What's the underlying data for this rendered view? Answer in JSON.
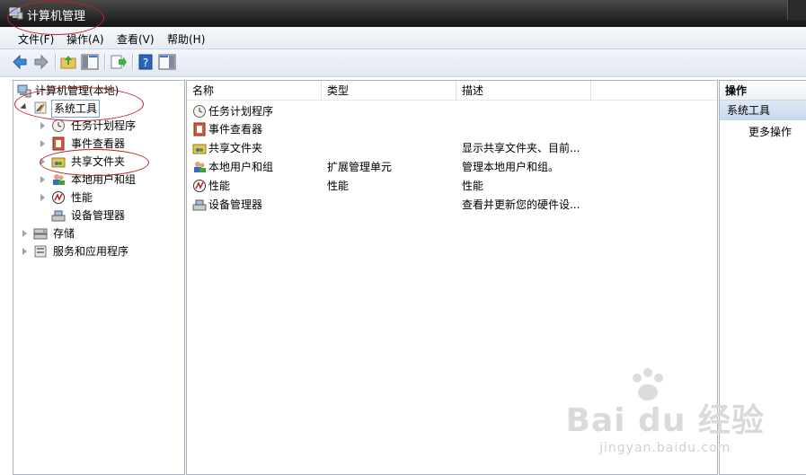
{
  "window": {
    "title": "计算机管理"
  },
  "menu": {
    "items": [
      "文件(F)",
      "操作(A)",
      "查看(V)",
      "帮助(H)"
    ]
  },
  "toolbar": {
    "icons": [
      "back-arrow-icon",
      "forward-arrow-icon",
      "up-folder-icon",
      "show-hide-tree-icon",
      "export-list-icon",
      "help-icon",
      "show-hide-action-pane-icon"
    ]
  },
  "tree": {
    "root": "计算机管理(本地)",
    "system_tools": "系统工具",
    "children": [
      "任务计划程序",
      "事件查看器",
      "共享文件夹",
      "本地用户和组",
      "性能",
      "设备管理器"
    ],
    "storage": "存储",
    "services": "服务和应用程序"
  },
  "list": {
    "columns": [
      "名称",
      "类型",
      "描述"
    ],
    "rows": [
      {
        "name": "任务计划程序",
        "type": "",
        "desc": ""
      },
      {
        "name": "事件查看器",
        "type": "",
        "desc": ""
      },
      {
        "name": "共享文件夹",
        "type": "",
        "desc": "显示共享文件夹、目前..."
      },
      {
        "name": "本地用户和组",
        "type": "扩展管理单元",
        "desc": "管理本地用户和组。"
      },
      {
        "name": "性能",
        "type": "性能",
        "desc": "性能"
      },
      {
        "name": "设备管理器",
        "type": "",
        "desc": "查看并更新您的硬件设..."
      }
    ]
  },
  "actions": {
    "header": "操作",
    "selected": "系统工具",
    "more": "更多操作"
  },
  "watermark": {
    "brand": "Bai du 经验",
    "url": "jingyan.baidu.com"
  },
  "colors": {
    "titlebar": "#1e1e1e",
    "selection": "#c6d8ee",
    "annotation": "#c0202a"
  }
}
